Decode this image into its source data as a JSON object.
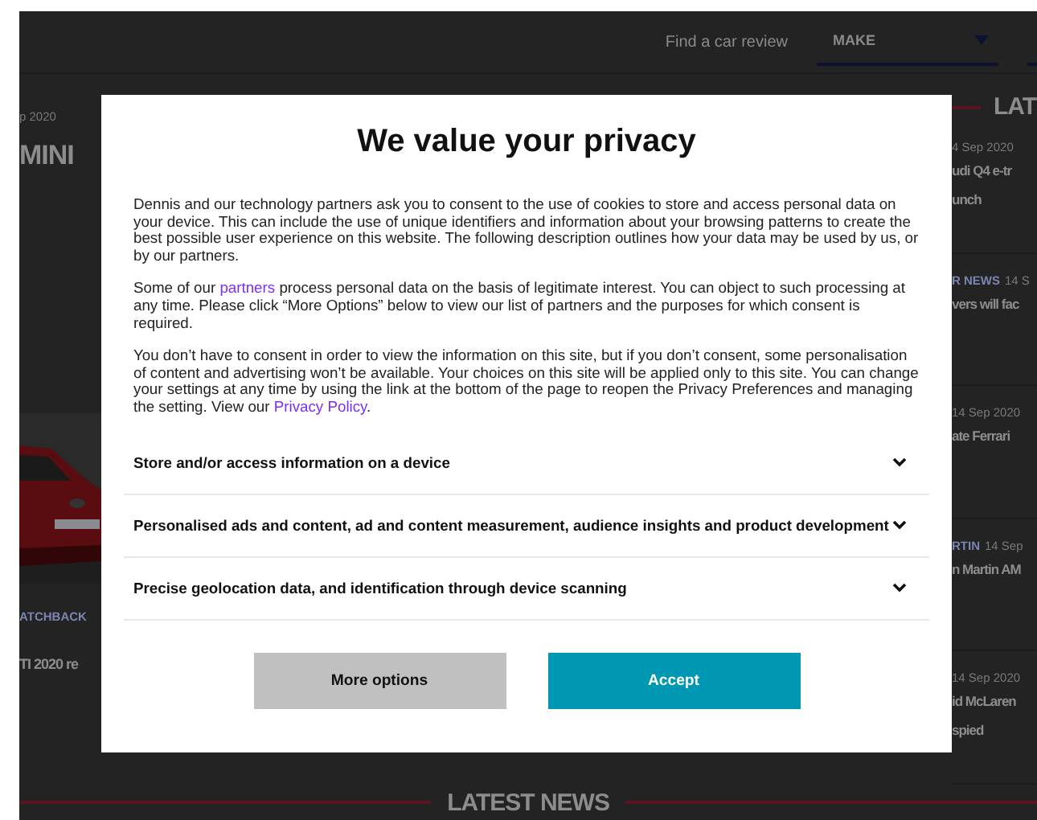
{
  "header": {
    "search_label": "Find a car review",
    "make_select": "MAKE"
  },
  "left_column": {
    "date": "p 2020",
    "headline": "MINI",
    "category": "ATCHBACK",
    "story": "TI 2020 re"
  },
  "right_column": {
    "heading": "LAT",
    "stories": [
      {
        "date": "4 Sep 2020",
        "title": [
          "udi Q4 e-tr",
          "unch"
        ]
      },
      {
        "category": "R NEWS",
        "date": "14 S",
        "title": [
          "vers will fac"
        ]
      },
      {
        "date": "14 Sep 2020",
        "title": [
          "ate Ferrari"
        ]
      },
      {
        "category": "RTIN",
        "date": "14 Sep",
        "title": [
          "n Martin AM"
        ]
      },
      {
        "date": "14 Sep 2020",
        "title": [
          "id McLaren",
          "spied"
        ]
      }
    ]
  },
  "footer": {
    "heading": "LATEST NEWS"
  },
  "dialog": {
    "title": "We value your privacy",
    "paragraphs": [
      [
        {
          "kind": "text",
          "text": "Dennis and our technology partners ask you to consent to the use of cookies to store and access personal data on your device. This can include the use of unique identifiers and information about your browsing patterns to create the best possible user experience on this website. The following description outlines how your data may be used by us, or by our partners."
        }
      ],
      [
        {
          "kind": "text",
          "text": "Some of our "
        },
        {
          "kind": "link",
          "text": "partners"
        },
        {
          "kind": "text",
          "text": " process personal data on the basis of legitimate interest. You can object to such processing at any time. Please click “More Options” below to view our list of partners and the purposes for which consent is required."
        }
      ],
      [
        {
          "kind": "text",
          "text": "You don’t have to consent in order to view the information on this site, but if you don’t consent, some personalisation of content and advertising won’t be available. Your choices on this site will be applied only to this site. You can change your settings at any time by using the link at the bottom of the page to reopen the Privacy Preferences and managing the setting. View our "
        },
        {
          "kind": "link",
          "text": "Privacy Policy"
        },
        {
          "kind": "text",
          "text": "."
        }
      ]
    ],
    "purposes": [
      {
        "label": "Store and/or access information on a device",
        "expanded": false
      },
      {
        "label": "Personalised ads and content, ad and content measurement, audience insights and product development",
        "expanded": false
      },
      {
        "label": "Precise geolocation data, and identification through device scanning",
        "expanded": false
      }
    ],
    "buttons": [
      {
        "label": "More options",
        "kind": "secondary"
      },
      {
        "label": "Accept",
        "kind": "primary"
      }
    ]
  }
}
